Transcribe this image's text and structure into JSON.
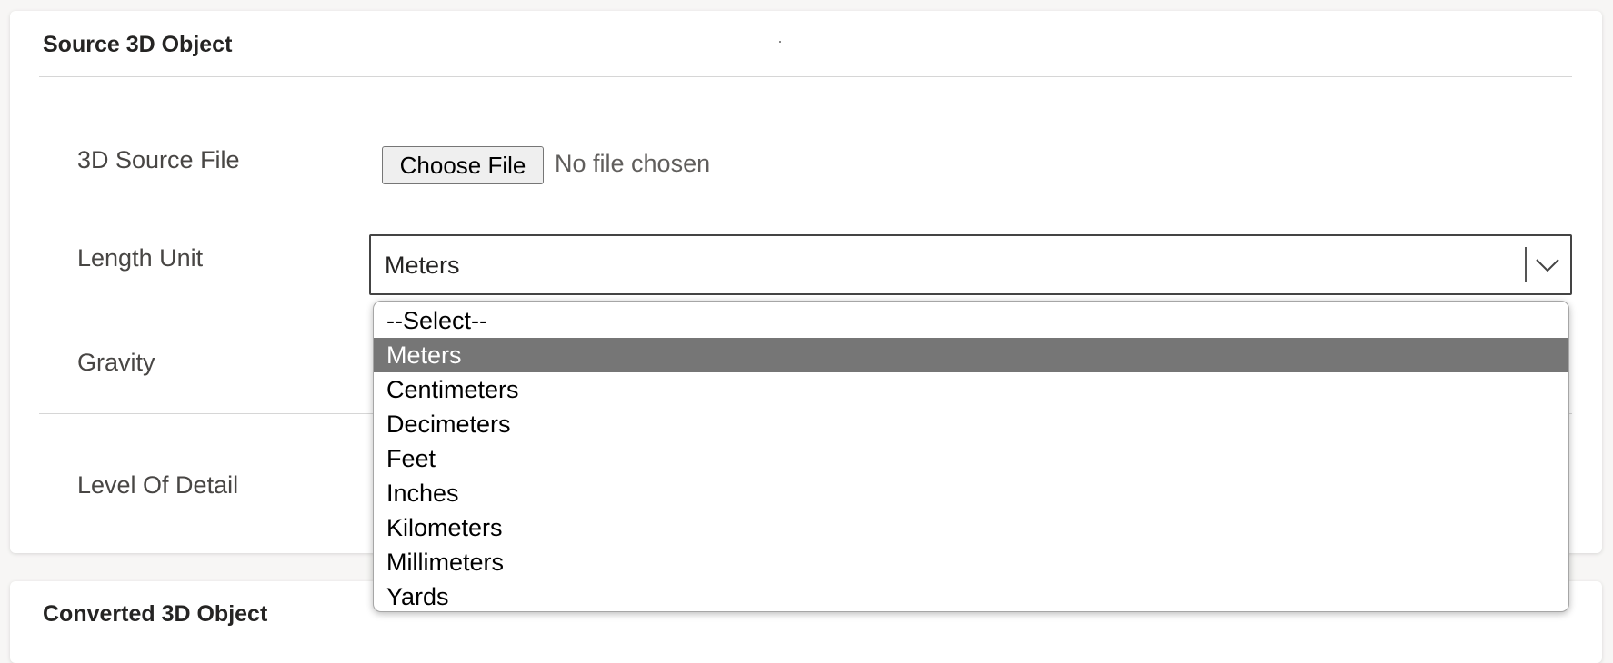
{
  "source_card": {
    "title": "Source 3D Object",
    "fields": {
      "source_file_label": "3D Source File",
      "choose_file_button": "Choose File",
      "file_status": "No file chosen",
      "length_unit_label": "Length Unit",
      "length_unit_value": "Meters",
      "gravity_label": "Gravity",
      "level_of_detail_label": "Level Of Detail"
    }
  },
  "dropdown": {
    "options": [
      "--Select--",
      "Meters",
      "Centimeters",
      "Decimeters",
      "Feet",
      "Inches",
      "Kilometers",
      "Millimeters",
      "Yards"
    ],
    "selected": "Meters"
  },
  "converted_card": {
    "title": "Converted 3D Object"
  },
  "icons": {
    "select_arrow": "chevron-down-icon"
  },
  "colors": {
    "highlight": "#767676",
    "card_background": "#ffffff",
    "page_background": "#f7f6f5"
  }
}
